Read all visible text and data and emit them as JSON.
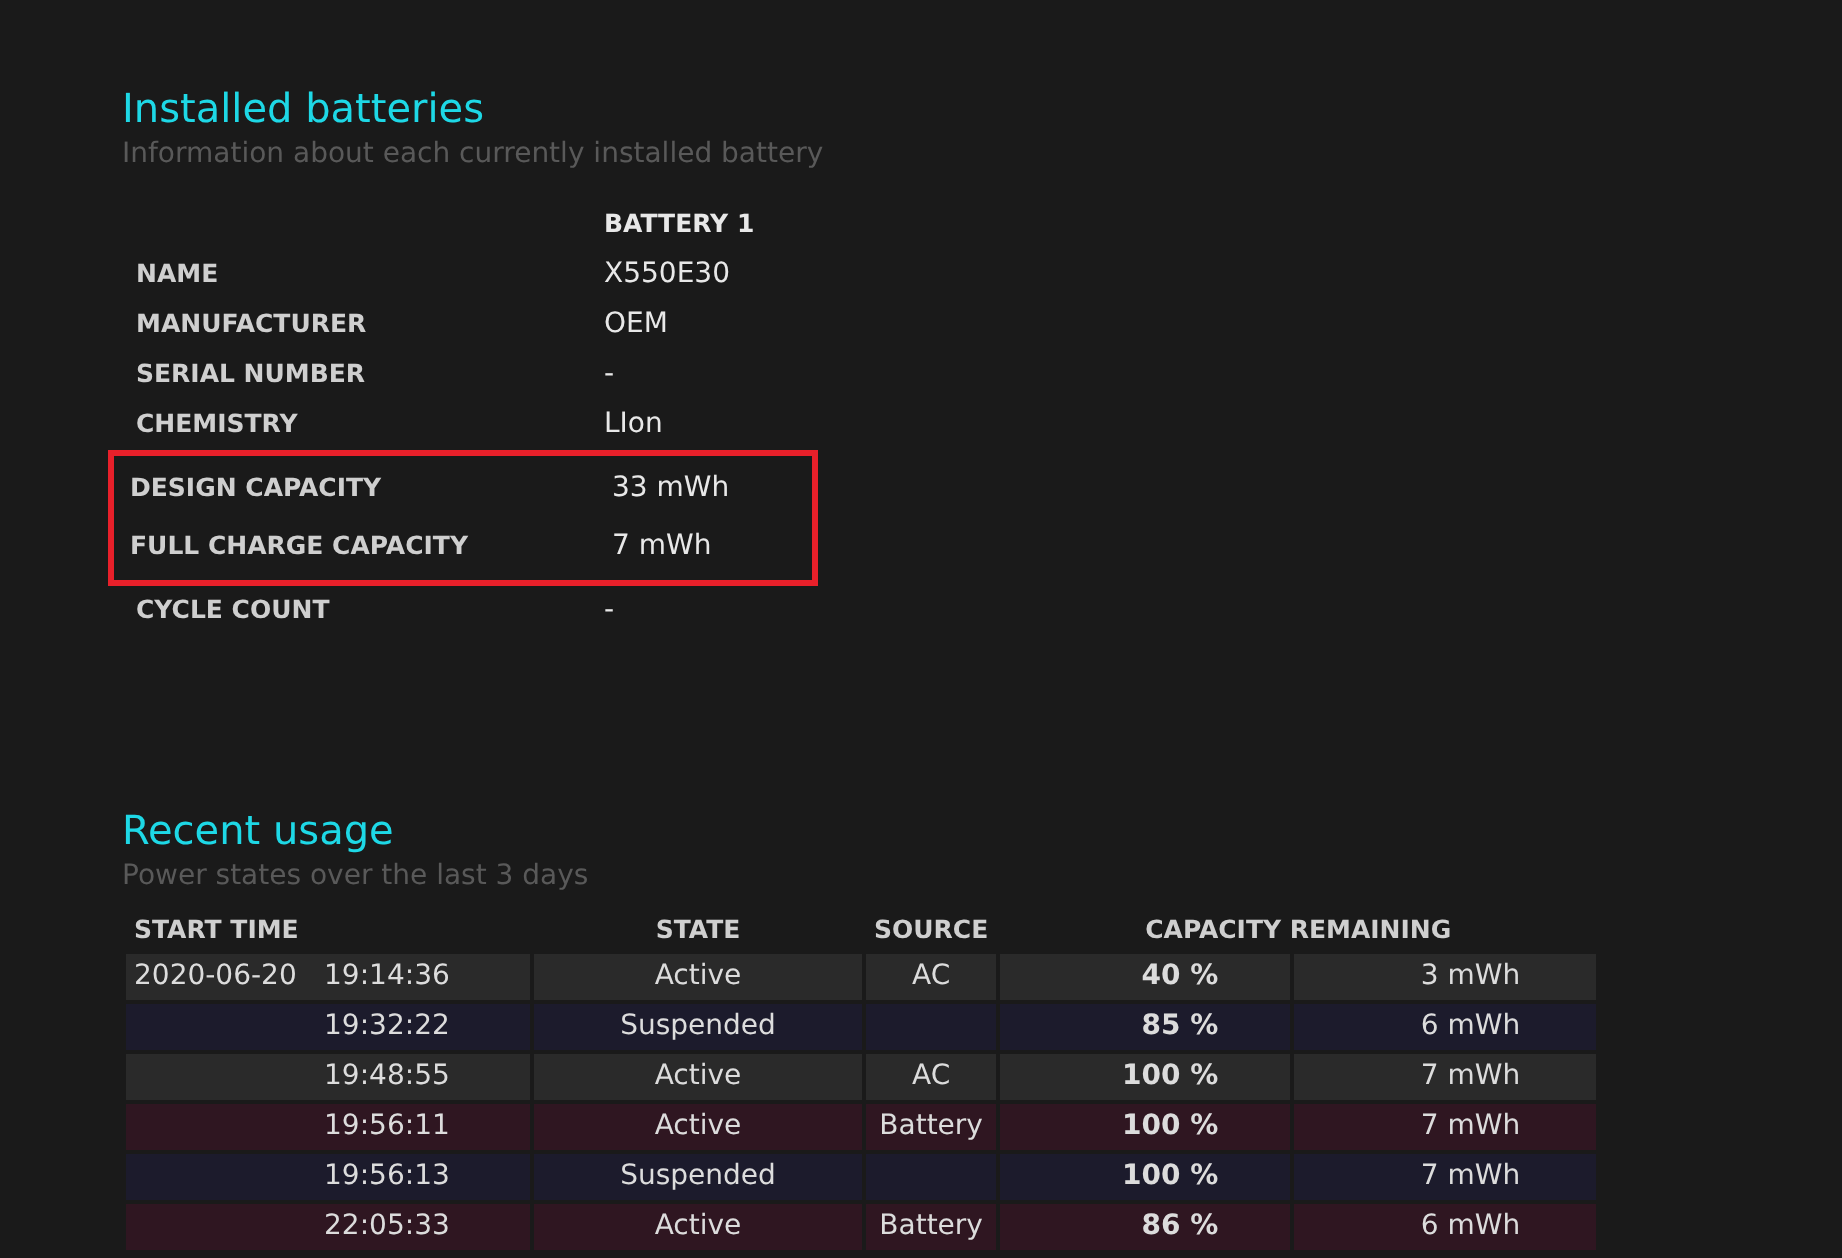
{
  "installed": {
    "title": "Installed batteries",
    "subtitle": "Information about each currently installed battery",
    "column_header": "BATTERY 1",
    "rows": [
      {
        "label": "NAME",
        "value": "X550E30",
        "highlighted": false
      },
      {
        "label": "MANUFACTURER",
        "value": "OEM",
        "highlighted": false
      },
      {
        "label": "SERIAL NUMBER",
        "value": "-",
        "highlighted": false
      },
      {
        "label": "CHEMISTRY",
        "value": "LIon",
        "highlighted": false
      },
      {
        "label": "DESIGN CAPACITY",
        "value": "33 mWh",
        "highlighted": true
      },
      {
        "label": "FULL CHARGE CAPACITY",
        "value": "7 mWh",
        "highlighted": true
      },
      {
        "label": "CYCLE COUNT",
        "value": "-",
        "highlighted": false
      }
    ]
  },
  "recent_usage": {
    "title": "Recent usage",
    "subtitle": "Power states over the last 3 days",
    "columns": [
      "START TIME",
      "STATE",
      "SOURCE",
      "CAPACITY REMAINING"
    ],
    "rows": [
      {
        "kind": "ac",
        "date": "2020-06-20",
        "time": "19:14:36",
        "state": "Active",
        "source": "AC",
        "percent": "40 %",
        "energy": "3 mWh"
      },
      {
        "kind": "suspended",
        "time": "19:32:22",
        "state": "Suspended",
        "percent": "85 %",
        "energy": "6 mWh"
      },
      {
        "kind": "ac",
        "time": "19:48:55",
        "state": "Active",
        "source": "AC",
        "percent": "100 %",
        "energy": "7 mWh"
      },
      {
        "kind": "battery",
        "time": "19:56:11",
        "state": "Active",
        "source": "Battery",
        "percent": "100 %",
        "energy": "7 mWh"
      },
      {
        "kind": "suspended",
        "time": "19:56:13",
        "state": "Suspended",
        "percent": "100 %",
        "energy": "7 mWh"
      },
      {
        "kind": "battery",
        "time": "22:05:33",
        "state": "Active",
        "source": "Battery",
        "percent": "86 %",
        "energy": "6 mWh"
      }
    ]
  }
}
